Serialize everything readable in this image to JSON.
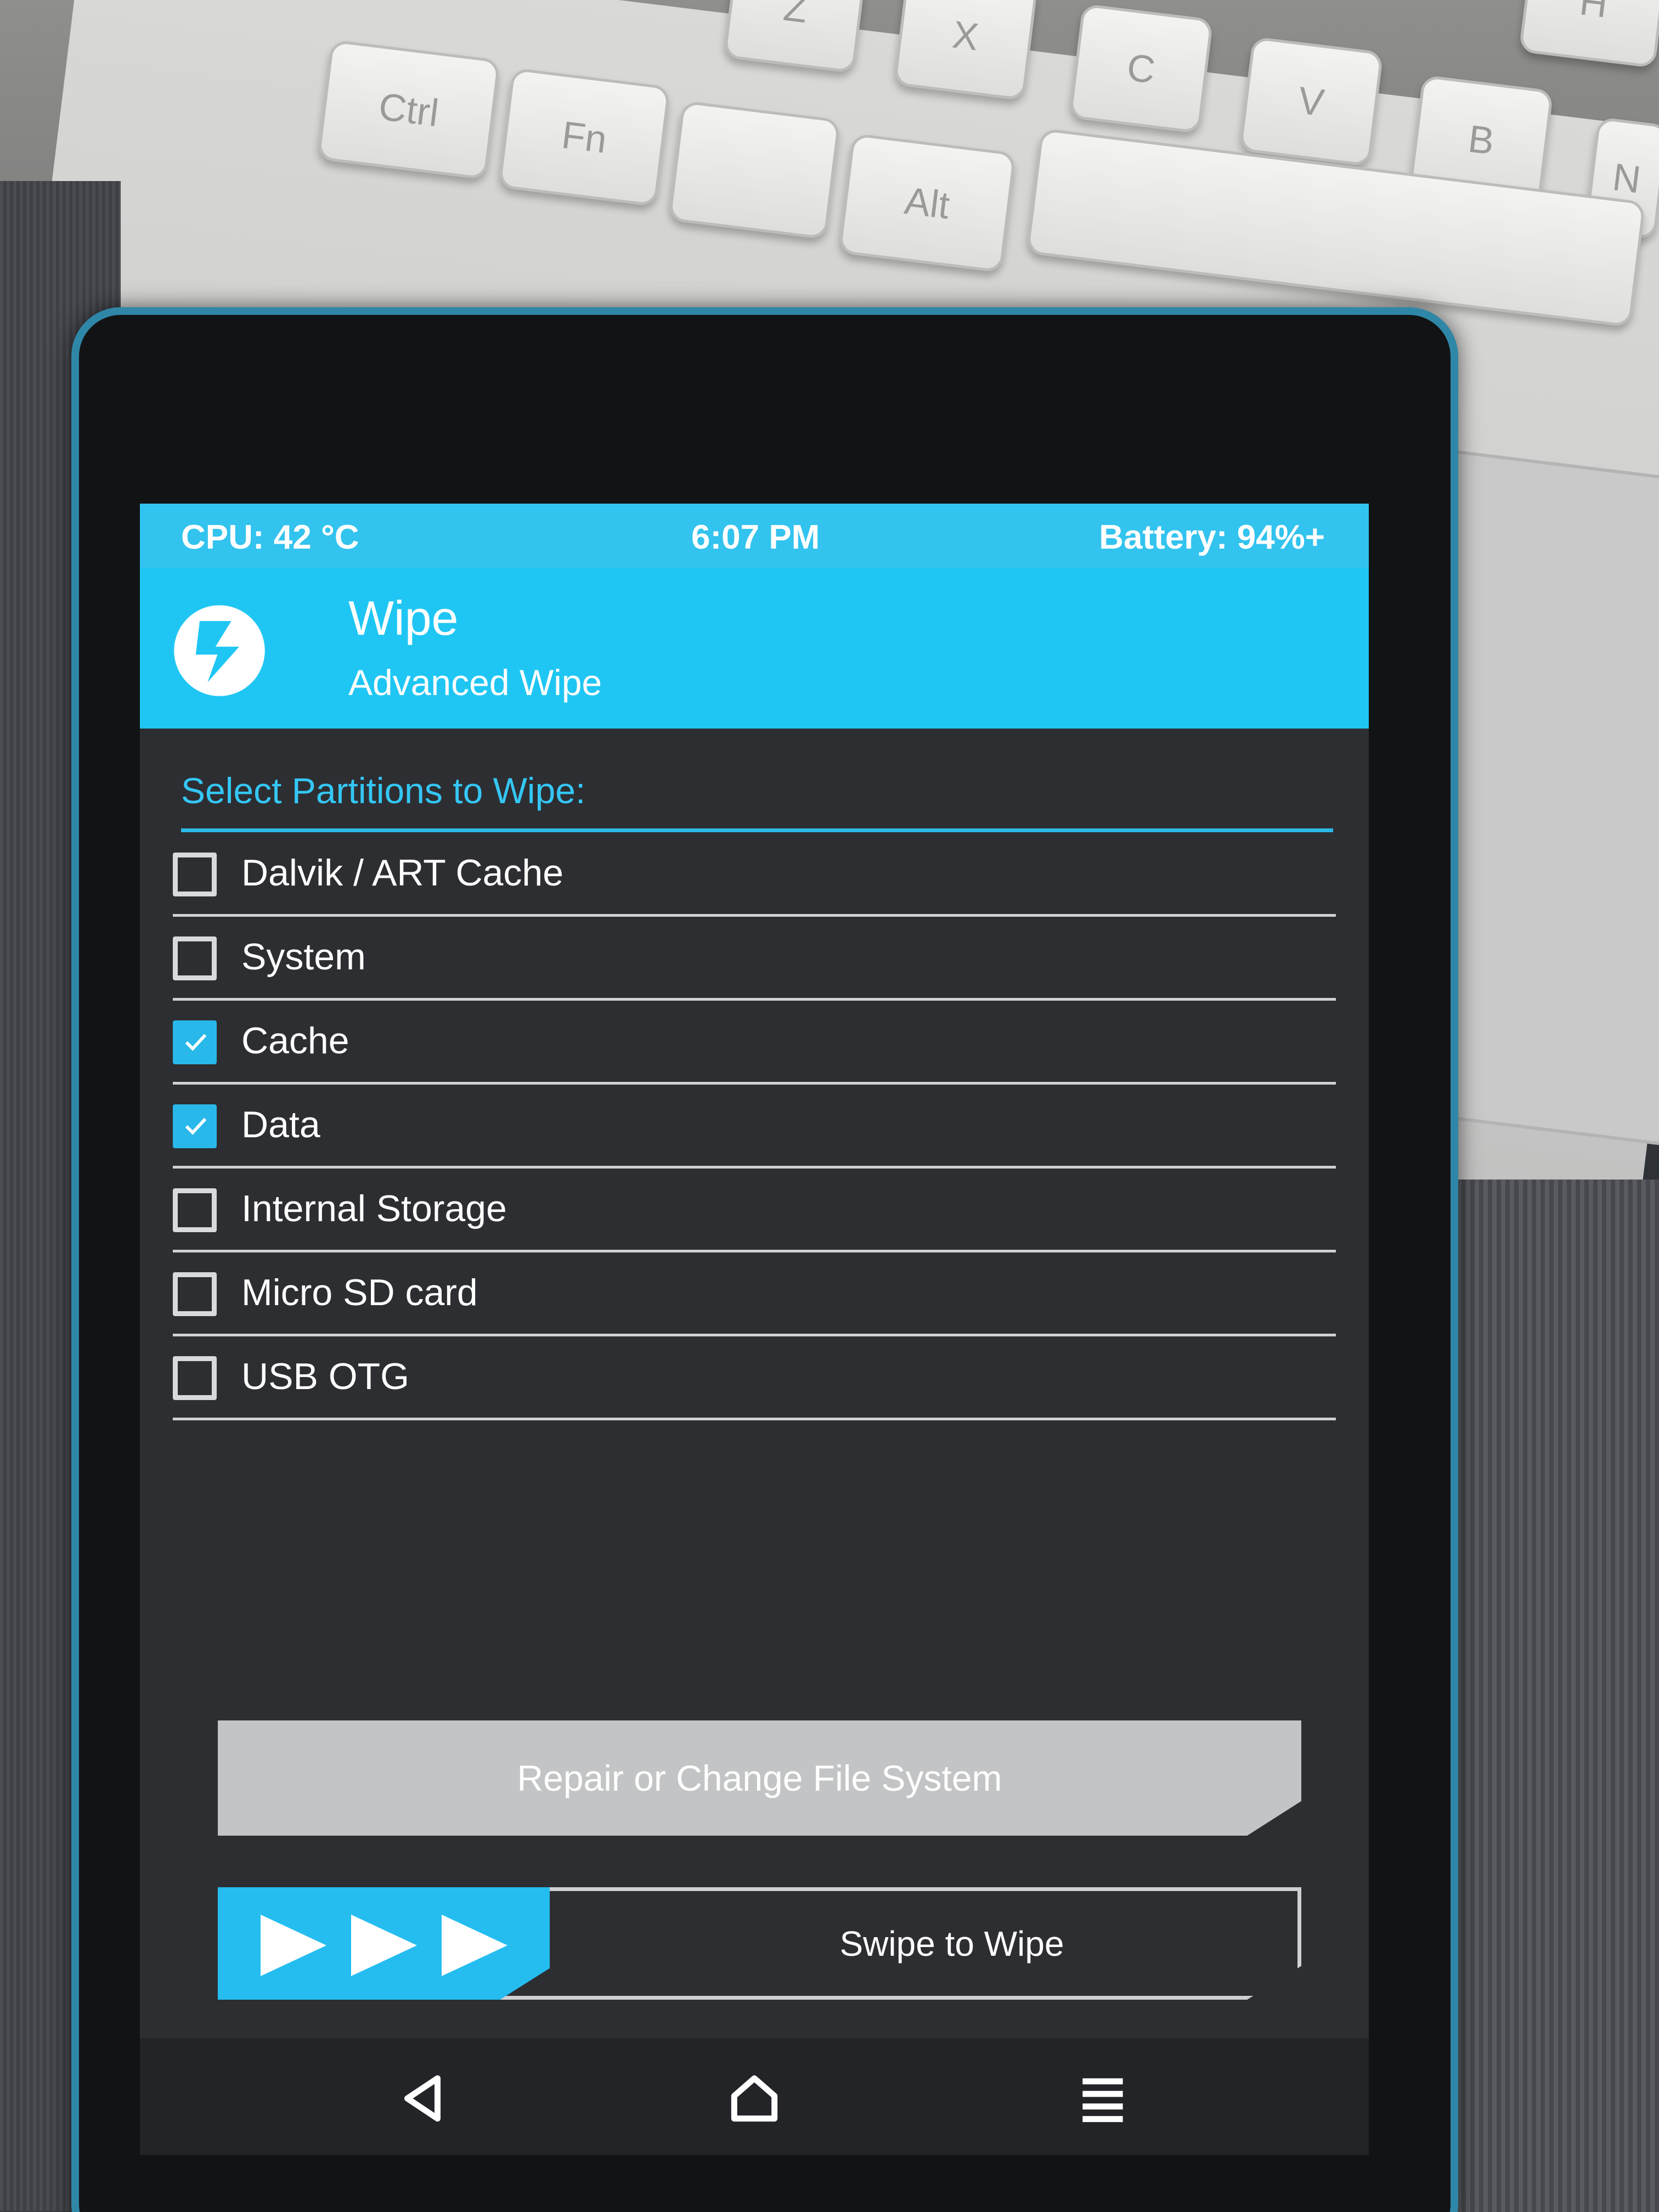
{
  "status_bar": {
    "cpu": "CPU: 42 °C",
    "time": "6:07 PM",
    "battery": "Battery: 94%+"
  },
  "header": {
    "title": "Wipe",
    "subtitle": "Advanced Wipe",
    "logo_icon": "twrp-logo-icon"
  },
  "section_label": "Select Partitions to Wipe:",
  "partitions": [
    {
      "label": "Dalvik / ART Cache",
      "checked": false
    },
    {
      "label": "System",
      "checked": false
    },
    {
      "label": "Cache",
      "checked": true
    },
    {
      "label": "Data",
      "checked": true
    },
    {
      "label": "Internal Storage",
      "checked": false
    },
    {
      "label": "Micro SD card",
      "checked": false
    },
    {
      "label": "USB OTG",
      "checked": false
    }
  ],
  "buttons": {
    "repair": "Repair or Change File System",
    "swipe": "Swipe to Wipe"
  },
  "nav": {
    "back_icon": "back-icon",
    "home_icon": "home-icon",
    "menu_icon": "menu-icon"
  },
  "keyboard": {
    "keys": [
      "Z",
      "X",
      "C",
      "V",
      "B",
      "H",
      "N",
      "Ctrl",
      "Fn",
      "Alt"
    ]
  },
  "colors": {
    "accent": "#1fc6f3",
    "background": "#2d2e32",
    "text": "#ffffff"
  }
}
